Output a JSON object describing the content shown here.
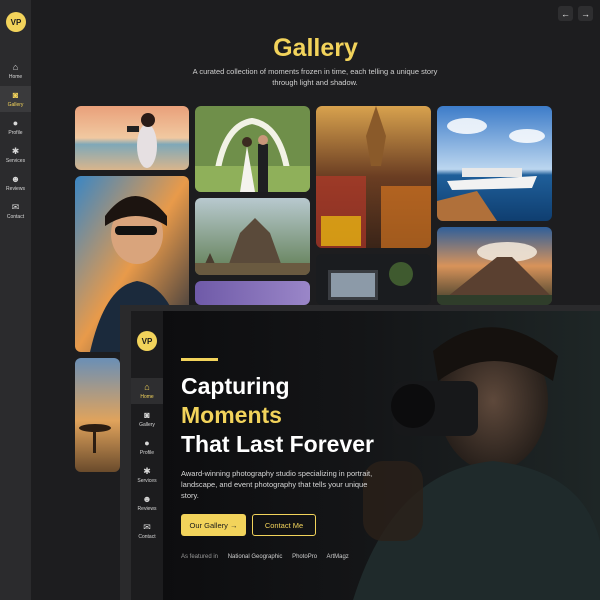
{
  "brand": {
    "logo_text": "VP"
  },
  "nav": {
    "items": [
      {
        "label": "Home",
        "icon": "home-icon"
      },
      {
        "label": "Gallery",
        "icon": "camera-icon"
      },
      {
        "label": "Profile",
        "icon": "user-icon"
      },
      {
        "label": "Services",
        "icon": "gear-icon"
      },
      {
        "label": "Reviews",
        "icon": "users-icon"
      },
      {
        "label": "Contact",
        "icon": "envelope-icon"
      }
    ]
  },
  "gallery": {
    "title": "Gallery",
    "subtitle": "A curated collection of moments frozen in time, each telling a unique story through light and shadow.",
    "prev_label": "←",
    "next_label": "→"
  },
  "hero": {
    "line1": "Capturing",
    "line2": "Moments",
    "line3": "That Last Forever",
    "description": "Award-winning photography studio specializing in portrait, landscape, and event photography that tells your unique story.",
    "primary_button": "Our Gallery →",
    "secondary_button": "Contact Me",
    "featured_label": "As featured in",
    "featured": [
      "National Geographic",
      "PhotoPro",
      "ArtMagz"
    ]
  },
  "colors": {
    "accent": "#f2d35b",
    "background": "#1d1d1f",
    "sidebar": "#2b2b2d"
  }
}
